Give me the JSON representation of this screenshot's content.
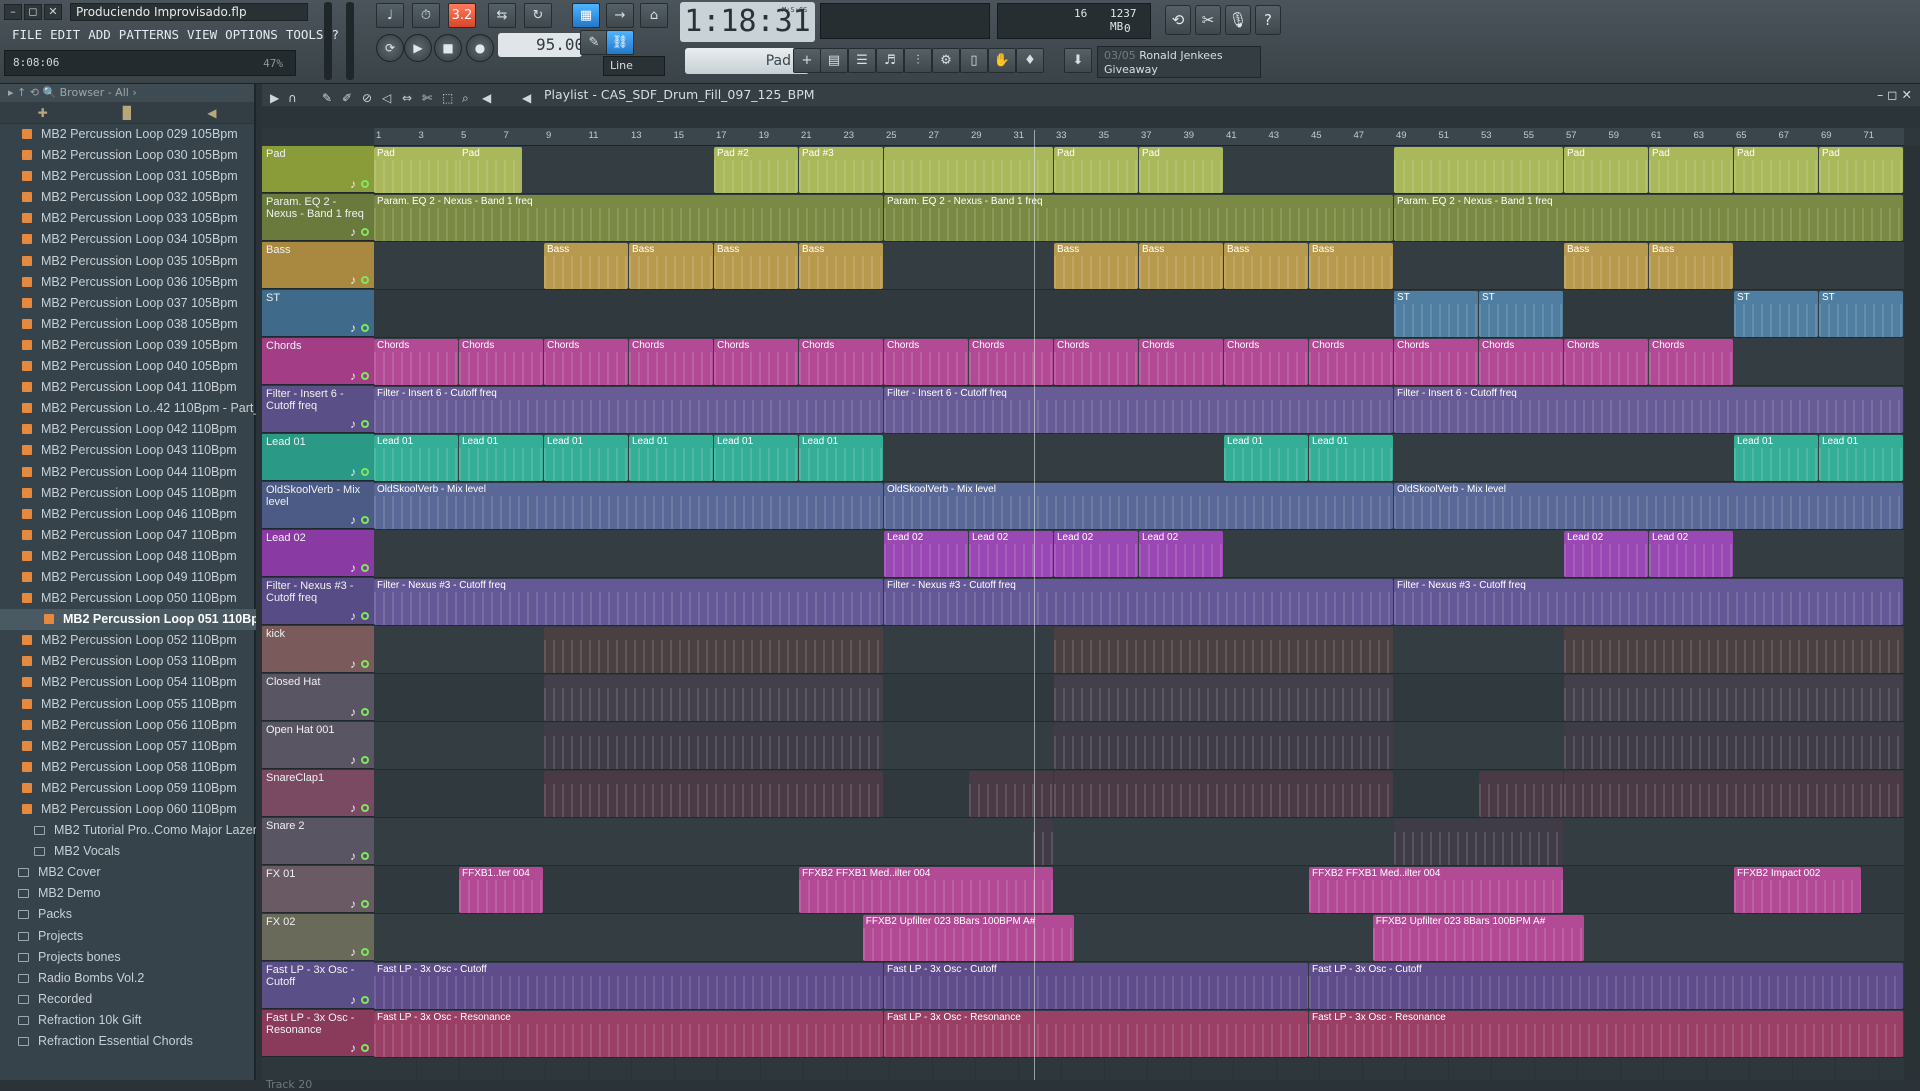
{
  "window": {
    "title": "Produciendo Improvisado.flp",
    "controls": [
      "–",
      "◻",
      "✕"
    ]
  },
  "menu": [
    "FILE",
    "EDIT",
    "ADD",
    "PATTERNS",
    "VIEW",
    "OPTIONS",
    "TOOLS",
    "?"
  ],
  "hint": {
    "time": "8:08:06",
    "percent": "47%"
  },
  "transport": {
    "counter": "1:18:31",
    "counter_unit": "M:S:CS",
    "tempo": "95.000",
    "pattern": "Pad",
    "snap": "Line",
    "pattern_mode": "3.2"
  },
  "cpu": {
    "value1": "16",
    "memory": "1237 MB",
    "value2": "0"
  },
  "news": {
    "count": "03/05",
    "text1": "Ronald Jenkees",
    "text2": "Giveaway"
  },
  "browser": {
    "header": "Browser - All",
    "items": [
      {
        "label": "MB2 Percussion Loop 029 105Bpm",
        "type": "file"
      },
      {
        "label": "MB2 Percussion Loop 030 105Bpm",
        "type": "file"
      },
      {
        "label": "MB2 Percussion Loop 031 105Bpm",
        "type": "file"
      },
      {
        "label": "MB2 Percussion Loop 032 105Bpm",
        "type": "file"
      },
      {
        "label": "MB2 Percussion Loop 033 105Bpm",
        "type": "file"
      },
      {
        "label": "MB2 Percussion Loop 034 105Bpm",
        "type": "file"
      },
      {
        "label": "MB2 Percussion Loop 035 105Bpm",
        "type": "file"
      },
      {
        "label": "MB2 Percussion Loop 036 105Bpm",
        "type": "file"
      },
      {
        "label": "MB2 Percussion Loop 037 105Bpm",
        "type": "file"
      },
      {
        "label": "MB2 Percussion Loop 038 105Bpm",
        "type": "file"
      },
      {
        "label": "MB2 Percussion Loop 039 105Bpm",
        "type": "file"
      },
      {
        "label": "MB2 Percussion Loop 040 105Bpm",
        "type": "file"
      },
      {
        "label": "MB2 Percussion Loop 041 110Bpm",
        "type": "file"
      },
      {
        "label": "MB2 Percussion Lo..42 110Bpm - Part_1",
        "type": "file"
      },
      {
        "label": "MB2 Percussion Loop 042 110Bpm",
        "type": "file"
      },
      {
        "label": "MB2 Percussion Loop 043 110Bpm",
        "type": "file"
      },
      {
        "label": "MB2 Percussion Loop 044 110Bpm",
        "type": "file"
      },
      {
        "label": "MB2 Percussion Loop 045 110Bpm",
        "type": "file"
      },
      {
        "label": "MB2 Percussion Loop 046 110Bpm",
        "type": "file"
      },
      {
        "label": "MB2 Percussion Loop 047 110Bpm",
        "type": "file"
      },
      {
        "label": "MB2 Percussion Loop 048 110Bpm",
        "type": "file"
      },
      {
        "label": "MB2 Percussion Loop 049 110Bpm",
        "type": "file"
      },
      {
        "label": "MB2 Percussion Loop 050 110Bpm",
        "type": "file"
      },
      {
        "label": "MB2 Percussion Loop 051 110Bpm",
        "type": "selected"
      },
      {
        "label": "MB2 Percussion Loop 052 110Bpm",
        "type": "file"
      },
      {
        "label": "MB2 Percussion Loop 053 110Bpm",
        "type": "file"
      },
      {
        "label": "MB2 Percussion Loop 054 110Bpm",
        "type": "file"
      },
      {
        "label": "MB2 Percussion Loop 055 110Bpm",
        "type": "file"
      },
      {
        "label": "MB2 Percussion Loop 056 110Bpm",
        "type": "file"
      },
      {
        "label": "MB2 Percussion Loop 057 110Bpm",
        "type": "file"
      },
      {
        "label": "MB2 Percussion Loop 058 110Bpm",
        "type": "file"
      },
      {
        "label": "MB2 Percussion Loop 059 110Bpm",
        "type": "file"
      },
      {
        "label": "MB2 Percussion Loop 060 110Bpm",
        "type": "file"
      },
      {
        "label": "MB2 Tutorial Pro..Como Major Lazer",
        "type": "sub"
      },
      {
        "label": "MB2 Vocals",
        "type": "sub"
      },
      {
        "label": "MB2 Cover",
        "type": "top"
      },
      {
        "label": "MB2 Demo",
        "type": "top"
      },
      {
        "label": "Packs",
        "type": "top"
      },
      {
        "label": "Projects",
        "type": "top"
      },
      {
        "label": "Projects bones",
        "type": "top"
      },
      {
        "label": "Radio Bombs Vol.2",
        "type": "top"
      },
      {
        "label": "Recorded",
        "type": "top"
      },
      {
        "label": "Refraction 10k Gift",
        "type": "top"
      },
      {
        "label": "Refraction Essential Chords",
        "type": "top"
      }
    ]
  },
  "playlist": {
    "title": "Playlist - CAS_SDF_Drum_Fill_097_125_BPM",
    "ruler": [
      "1",
      "3",
      "5",
      "7",
      "9",
      "11",
      "13",
      "15",
      "17",
      "19",
      "21",
      "23",
      "25",
      "27",
      "29",
      "31",
      "33",
      "35",
      "37",
      "39",
      "41",
      "43",
      "45",
      "47",
      "49",
      "51",
      "53",
      "55",
      "57",
      "59",
      "61",
      "63",
      "65",
      "67",
      "69",
      "71"
    ],
    "tracks": [
      {
        "name": "Pad",
        "color": "#8a9b3a",
        "clip_color": "#a8b85a",
        "clips": [
          [
            1,
            8,
            "Pad"
          ],
          [
            5,
            8,
            "Pad"
          ],
          [
            17,
            21,
            "Pad #2"
          ],
          [
            21,
            25,
            "Pad #3"
          ],
          [
            25,
            33,
            ""
          ],
          [
            33,
            37,
            "Pad"
          ],
          [
            37,
            41,
            "Pad"
          ],
          [
            49,
            57,
            ""
          ],
          [
            57,
            61,
            "Pad"
          ],
          [
            61,
            65,
            "Pad"
          ],
          [
            65,
            69,
            "Pad"
          ],
          [
            69,
            73,
            "Pad"
          ]
        ]
      },
      {
        "name": "Param. EQ 2 - Nexus - Band 1 freq",
        "color": "#6a7a3c",
        "clip_color": "#7a8a44",
        "clips": [
          [
            1,
            25,
            "Param. EQ 2 - Nexus - Band 1 freq"
          ],
          [
            25,
            49,
            "Param. EQ 2 - Nexus - Band 1 freq"
          ],
          [
            49,
            73,
            "Param. EQ 2 - Nexus - Band 1 freq"
          ]
        ]
      },
      {
        "name": "Bass",
        "color": "#a9893f",
        "clip_color": "#b89a4e",
        "clips": [
          [
            9,
            13,
            "Bass"
          ],
          [
            13,
            17,
            "Bass"
          ],
          [
            17,
            21,
            "Bass"
          ],
          [
            21,
            25,
            "Bass"
          ],
          [
            33,
            37,
            "Bass"
          ],
          [
            37,
            41,
            "Bass"
          ],
          [
            41,
            45,
            "Bass"
          ],
          [
            45,
            49,
            "Bass"
          ],
          [
            57,
            61,
            "Bass"
          ],
          [
            61,
            65,
            "Bass"
          ]
        ]
      },
      {
        "name": "ST",
        "color": "#3f6a8a",
        "clip_color": "#4f7ea0",
        "clips": [
          [
            49,
            53,
            "ST"
          ],
          [
            53,
            57,
            "ST"
          ],
          [
            65,
            69,
            "ST"
          ],
          [
            69,
            73,
            "ST"
          ]
        ]
      },
      {
        "name": "Chords",
        "color": "#a33d86",
        "clip_color": "#b24a95",
        "clips": [
          [
            1,
            5,
            "Chords"
          ],
          [
            5,
            9,
            "Chords"
          ],
          [
            9,
            13,
            "Chords"
          ],
          [
            13,
            17,
            "Chords"
          ],
          [
            17,
            21,
            "Chords"
          ],
          [
            21,
            25,
            "Chords"
          ],
          [
            25,
            29,
            "Chords"
          ],
          [
            29,
            33,
            "Chords"
          ],
          [
            33,
            37,
            "Chords"
          ],
          [
            37,
            41,
            "Chords"
          ],
          [
            41,
            45,
            "Chords"
          ],
          [
            45,
            49,
            "Chords"
          ],
          [
            49,
            53,
            "Chords"
          ],
          [
            53,
            57,
            "Chords"
          ],
          [
            57,
            61,
            "Chords"
          ],
          [
            61,
            65,
            "Chords"
          ]
        ]
      },
      {
        "name": "Filter - Insert 6 - Cutoff freq",
        "color": "#5a4f86",
        "clip_color": "#675c96",
        "clips": [
          [
            1,
            25,
            "Filter - Insert 6 - Cutoff freq"
          ],
          [
            25,
            49,
            "Filter - Insert 6 - Cutoff freq"
          ],
          [
            49,
            73,
            "Filter - Insert 6 - Cutoff freq"
          ]
        ]
      },
      {
        "name": "Lead 01",
        "color": "#2a9a86",
        "clip_color": "#35ae97",
        "clips": [
          [
            1,
            5,
            "Lead 01"
          ],
          [
            5,
            9,
            "Lead 01"
          ],
          [
            9,
            13,
            "Lead 01"
          ],
          [
            13,
            17,
            "Lead 01"
          ],
          [
            17,
            21,
            "Lead 01"
          ],
          [
            21,
            25,
            "Lead 01"
          ],
          [
            41,
            45,
            "Lead 01"
          ],
          [
            45,
            49,
            "Lead 01"
          ],
          [
            65,
            69,
            "Lead 01"
          ],
          [
            69,
            73,
            "Lead 01"
          ]
        ]
      },
      {
        "name": "OldSkoolVerb - Mix level",
        "color": "#4c5a86",
        "clip_color": "#596896",
        "clips": [
          [
            1,
            25,
            "OldSkoolVerb - Mix level"
          ],
          [
            25,
            49,
            "OldSkoolVerb - Mix level"
          ],
          [
            49,
            73,
            "OldSkoolVerb - Mix level"
          ]
        ]
      },
      {
        "name": "Lead 02",
        "color": "#8a3aa3",
        "clip_color": "#9a48b3",
        "clips": [
          [
            25,
            29,
            "Lead 02"
          ],
          [
            29,
            33,
            "Lead 02"
          ],
          [
            33,
            37,
            "Lead 02"
          ],
          [
            37,
            41,
            "Lead 02"
          ],
          [
            57,
            61,
            "Lead 02"
          ],
          [
            61,
            65,
            "Lead 02"
          ]
        ]
      },
      {
        "name": "Filter - Nexus #3 - Cutoff freq",
        "color": "#574c86",
        "clip_color": "#645996",
        "clips": [
          [
            1,
            25,
            "Filter - Nexus #3 - Cutoff freq"
          ],
          [
            25,
            49,
            "Filter - Nexus #3 - Cutoff freq"
          ],
          [
            49,
            73,
            "Filter - Nexus #3 - Cutoff freq"
          ]
        ]
      },
      {
        "name": "kick",
        "color": "#7a5a5a",
        "clip_color": "#4a3f41",
        "clips": [
          [
            9,
            25,
            ""
          ],
          [
            33,
            49,
            ""
          ],
          [
            57,
            73,
            ""
          ]
        ]
      },
      {
        "name": "Closed Hat",
        "color": "#5a5563",
        "clip_color": "#433f4b",
        "clips": [
          [
            9,
            25,
            ""
          ],
          [
            33,
            49,
            ""
          ],
          [
            57,
            73,
            ""
          ]
        ]
      },
      {
        "name": "Open Hat 001",
        "color": "#5a5563",
        "clip_color": "#3f3b47",
        "clips": [
          [
            9,
            25,
            ""
          ],
          [
            33,
            49,
            ""
          ],
          [
            57,
            73,
            ""
          ]
        ]
      },
      {
        "name": "SnareClap1",
        "color": "#7a4a63",
        "clip_color": "#4a3a45",
        "clips": [
          [
            9,
            25,
            ""
          ],
          [
            29,
            33,
            ""
          ],
          [
            33,
            49,
            ""
          ],
          [
            53,
            57,
            ""
          ],
          [
            57,
            73,
            ""
          ]
        ]
      },
      {
        "name": "Snare 2",
        "color": "#5a5563",
        "clip_color": "#3f3b47",
        "clips": [
          [
            32,
            33,
            ""
          ],
          [
            49,
            57,
            ""
          ]
        ]
      },
      {
        "name": "FX 01",
        "color": "#6a5a63",
        "clip_color": "#b24a95",
        "clips": [
          [
            5,
            9,
            "FFXB1..ter 004"
          ],
          [
            21,
            33,
            "FFXB2 FFXB1 Med..ilter 004"
          ],
          [
            45,
            57,
            "FFXB2 FFXB1 Med..ilter 004"
          ],
          [
            65,
            71,
            "FFXB2 Impact 002"
          ]
        ]
      },
      {
        "name": "FX 02",
        "color": "#6a6a5a",
        "clip_color": "#b24a95",
        "clips": [
          [
            24,
            34,
            "FFXB2 Upfilter 023 8Bars 100BPM A#"
          ],
          [
            48,
            58,
            "FFXB2 Upfilter 023 8Bars 100BPM A#"
          ]
        ]
      },
      {
        "name": "Fast LP - 3x Osc - Cutoff",
        "color": "#5a4f86",
        "clip_color": "#5f4c8a",
        "clips": [
          [
            1,
            25,
            "Fast LP - 3x Osc - Cutoff"
          ],
          [
            25,
            45,
            "Fast LP - 3x Osc - Cutoff"
          ],
          [
            45,
            73,
            "Fast LP - 3x Osc - Cutoff"
          ]
        ]
      },
      {
        "name": "Fast LP - 3x Osc - Resonance",
        "color": "#8a3a5a",
        "clip_color": "#9a3f65",
        "clips": [
          [
            1,
            25,
            "Fast LP - 3x Osc - Resonance"
          ],
          [
            25,
            45,
            "Fast LP - 3x Osc - Resonance"
          ],
          [
            45,
            73,
            "Fast LP - 3x Osc - Resonance"
          ]
        ]
      }
    ],
    "last_track": "Track 20"
  }
}
